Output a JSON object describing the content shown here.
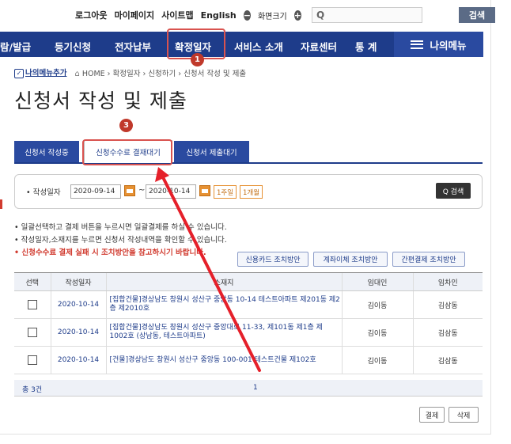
{
  "util": {
    "logout": "로그아웃",
    "mypage": "마이페이지",
    "sitemap": "사이트맵",
    "english": "English",
    "zoom_minus": "−",
    "zoom_label": "화면크기",
    "zoom_plus": "+",
    "search_placeholder": "Q",
    "search_button": "검색"
  },
  "nav": {
    "items": [
      "람/발급",
      "등기신청",
      "전자납부",
      "확정일자",
      "서비스 소개",
      "자료센터",
      "통 계"
    ],
    "menu_button": "나의메뉴",
    "active_index": 3
  },
  "badges": {
    "b1": "1",
    "b3": "3"
  },
  "breadcrumb": {
    "mymenu": "나의메뉴추가",
    "path": "HOME › 확정일자 › 신청하기 › 신청서 작성 및 제출"
  },
  "page_title": "신청서 작성 및 제출",
  "tabs": [
    "신청서 작성중",
    "신청수수료 결재대기",
    "신청서 제출대기"
  ],
  "active_tab": 1,
  "search": {
    "label": "• 작성일자",
    "date_from": "2020-09-14",
    "tilde": "~",
    "date_to": "2020-10-14",
    "chip_week": "1주일",
    "chip_month": "1개월",
    "button": "Q 검색"
  },
  "notes": [
    "• 일괄선택하고 결제 버튼을 누르시면 일괄결제를 하실 수 있습니다.",
    "• 작성일자,소재지를 누르면 신청서 작성내역을 확인할 수 있습니다.",
    "• 신청수수료 결제 실패 시 조치방안을 참고하시기 바랍니다."
  ],
  "guide_buttons": [
    "신용카드 조치방안",
    "계좌이체 조치방안",
    "간편결제 조치방안"
  ],
  "table": {
    "headers": [
      "선택",
      "작성일자",
      "소재지",
      "임대인",
      "임차인"
    ],
    "rows": [
      {
        "date": "2020-10-14",
        "address": "[집합건물]경상남도 창원시 성산구 중앙동 10-14 테스트아파트 제201동 제2층 제2010호",
        "landlord": "김이동",
        "tenant": "김삼동"
      },
      {
        "date": "2020-10-14",
        "address": "[집합건물]경상남도 창원시 성산구 중앙대로 11-33, 제101동 제1층 제1002호 (상남동, 테스트아파트)",
        "landlord": "김이동",
        "tenant": "김삼동"
      },
      {
        "date": "2020-10-14",
        "address": "[건물]경상남도 창원시 성산구 중앙동 100-001 테스트건물 제102호",
        "landlord": "김이동",
        "tenant": "김삼동"
      }
    ],
    "total": "총 3건",
    "page": "1"
  },
  "actions": {
    "pay": "결제",
    "delete": "삭제"
  },
  "colors": {
    "nav_bg": "#1e3c8a",
    "highlight": "#d9534f",
    "badge": "#c0392b"
  }
}
